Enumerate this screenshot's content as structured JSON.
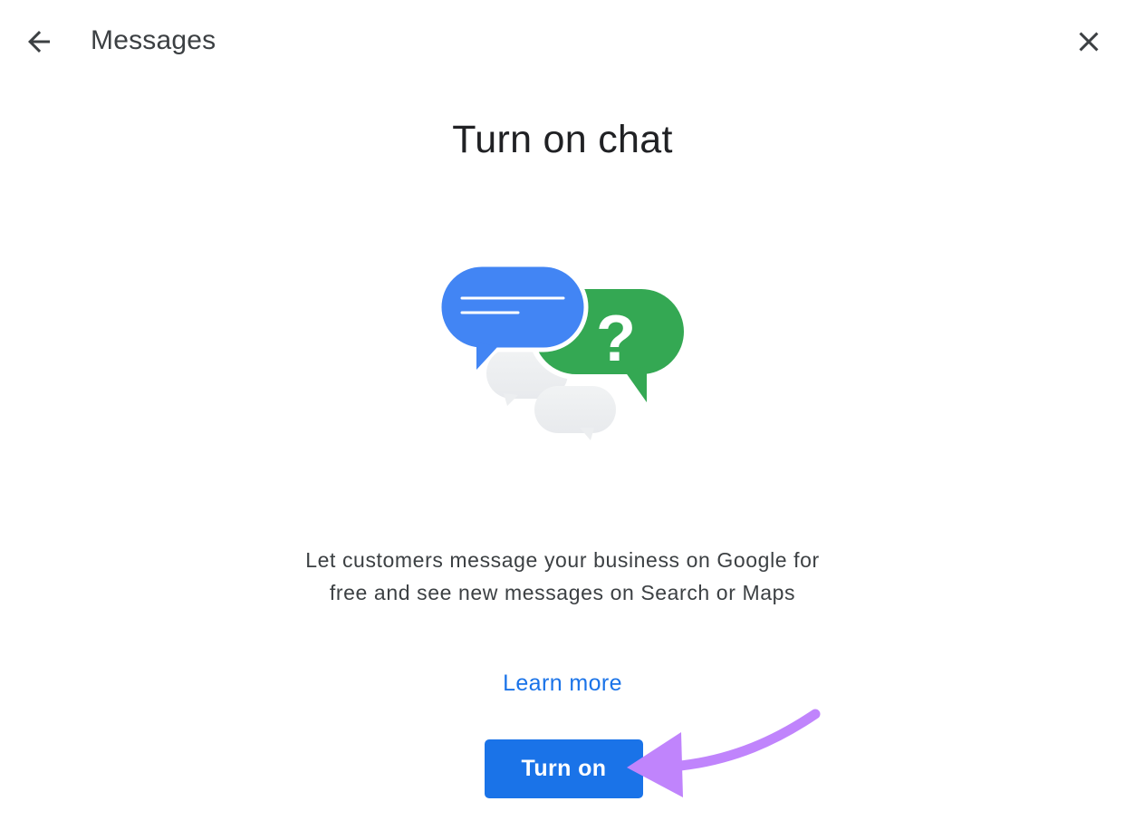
{
  "header": {
    "title": "Messages",
    "back_icon": "arrow-back-icon",
    "close_icon": "close-icon"
  },
  "main": {
    "title": "Turn on chat",
    "illustration_icon": "chat-bubbles-illustration",
    "description": "Let customers message your business on Google for free and see new messages on Search or Maps",
    "learn_more": "Learn more",
    "turn_on_button": "Turn on"
  },
  "colors": {
    "accent_blue": "#1a73e8",
    "bubble_blue": "#4285f4",
    "bubble_green": "#34a853",
    "annotation_purple": "#c084fc"
  }
}
